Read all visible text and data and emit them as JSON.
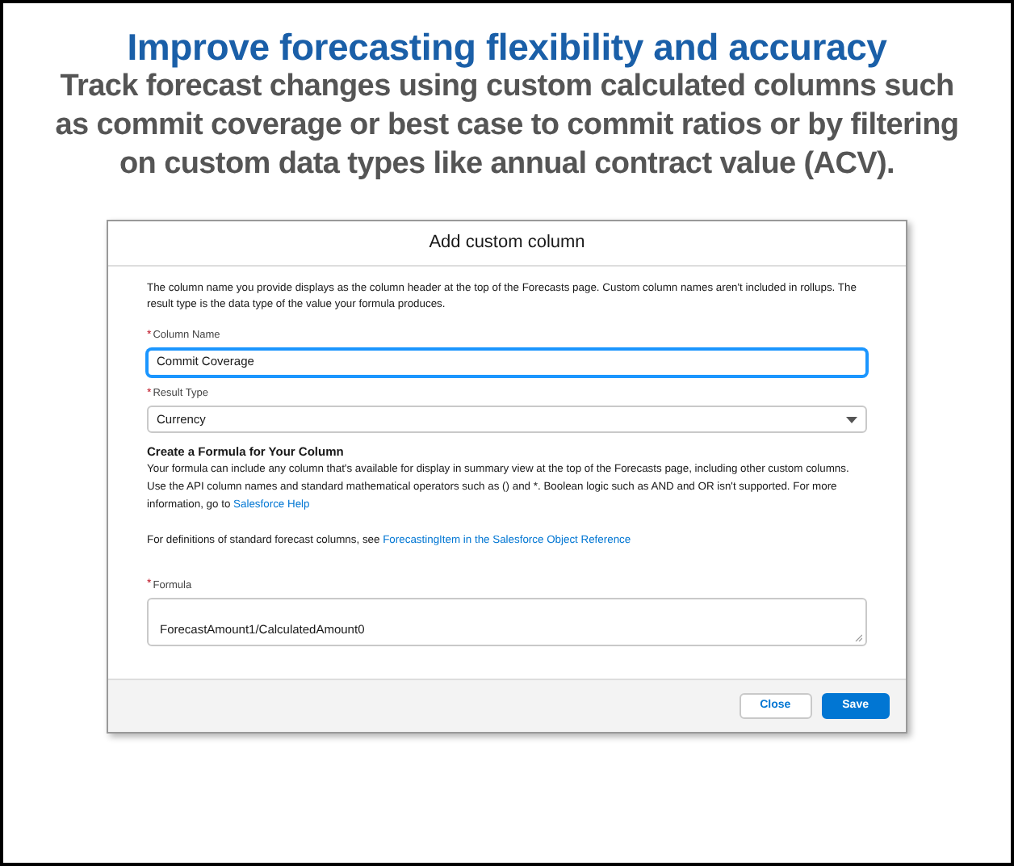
{
  "heading": "Improve forecasting flexibility and accuracy",
  "subheading": "Track forecast changes using custom calculated columns such as commit coverage or best case to commit ratios or by filtering on custom data types like annual contract value (ACV).",
  "dialog": {
    "title": "Add custom column",
    "intro": "The column name you provide displays as the column header at the top of the Forecasts page. Custom column names aren't included in rollups. The result type is the data type of the value your formula produces.",
    "fields_top": [
      {
        "kind": "input",
        "required_mark": "*",
        "label": "Column Name",
        "value": "Commit Coverage",
        "focused": true
      },
      {
        "kind": "select",
        "required_mark": "*",
        "label": "Result Type",
        "value": "Currency",
        "focused": false
      }
    ],
    "section_heading": "Create a Formula for Your Column",
    "section_body": {
      "text": "Your formula can include any column that's available for display in summary view at the top of the Forecasts page, including other custom columns. Use the API column names and standard mathematical operators such as () and *. Boolean logic such as AND and OR isn't supported. For more information, go to",
      "link": "Salesforce Help"
    },
    "definitions": {
      "text": "For definitions of standard forecast columns, see",
      "link": "ForecastingItem in the Salesforce Object Reference"
    },
    "fields_bottom": [
      {
        "kind": "textarea",
        "required_mark": "*",
        "label": "Formula",
        "value": "ForecastAmount1/CalculatedAmount0",
        "focused": false
      }
    ],
    "buttons": [
      {
        "label": "Close",
        "primary": false
      },
      {
        "label": "Save",
        "primary": true
      }
    ]
  }
}
